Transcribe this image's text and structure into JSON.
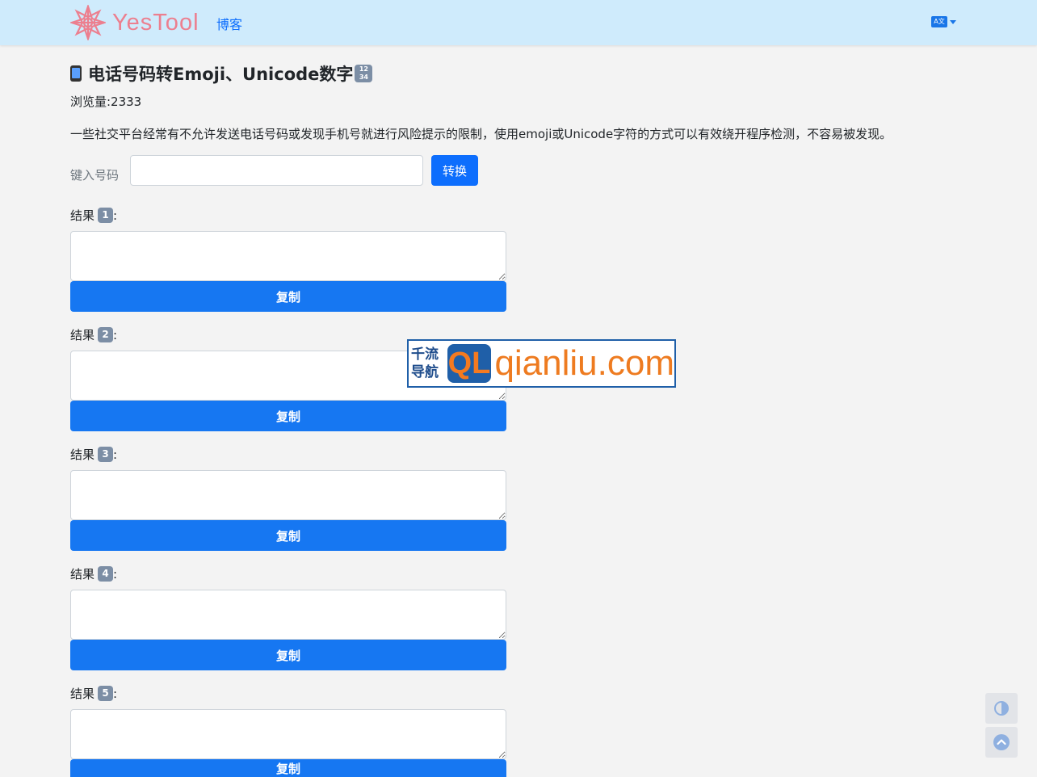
{
  "navbar": {
    "brand_name": "YesTool",
    "blog_link": "博客",
    "language_icon": "translate-icon"
  },
  "page": {
    "title": "电话号码转Emoji、Unicode数字",
    "title_icons": [
      "mobile-phone-icon",
      "keycap-1234-icon"
    ],
    "views": "浏览量:2333",
    "description": "一些社交平台经常有不允许发送电话号码或发现手机号就进行风险提示的限制，使用emoji或Unicode字符的方式可以有效绕开程序检测，不容易被发现。"
  },
  "form": {
    "input_label": "键入号码",
    "input_value": "",
    "input_placeholder": "",
    "convert_button": "转换"
  },
  "results": [
    {
      "label": "结果",
      "keycap": "1",
      "suffix": ":",
      "value": "",
      "copy_button": "复制"
    },
    {
      "label": "结果",
      "keycap": "2",
      "suffix": ":",
      "value": "",
      "copy_button": "复制"
    },
    {
      "label": "结果",
      "keycap": "3",
      "suffix": ":",
      "value": "",
      "copy_button": "复制"
    },
    {
      "label": "结果",
      "keycap": "4",
      "suffix": ":",
      "value": "",
      "copy_button": "复制"
    },
    {
      "label": "结果",
      "keycap": "5",
      "suffix": ":",
      "value": "",
      "copy_button": "复制"
    }
  ],
  "watermark": {
    "cn_line1": "千流",
    "cn_line2": "导航",
    "logo_letters": "QL",
    "url": "qianliu.com"
  },
  "floating": {
    "theme_toggle_icon": "contrast-icon",
    "back_to_top_icon": "arrow-up-circle-icon"
  },
  "colors": {
    "navbar_bg": "#cfebfc",
    "primary": "#0d6efd",
    "brand": "#ec7f8f",
    "page_bg": "#f3f3f3"
  }
}
